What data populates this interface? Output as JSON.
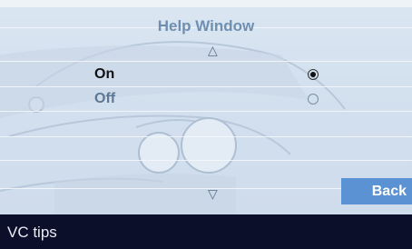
{
  "window": {
    "title": "Help Window"
  },
  "nav": {
    "up_icon": "triangle-up-icon",
    "up_glyph": "△",
    "down_icon": "triangle-down-icon",
    "down_glyph": "▽"
  },
  "options": [
    {
      "label": "On",
      "selected": true
    },
    {
      "label": "Off",
      "selected": false
    }
  ],
  "buttons": {
    "back_label": "Back"
  },
  "status": {
    "text": "VC tips"
  },
  "colors": {
    "background": "#d3e0ee",
    "title": "#6f8fb1",
    "selected_text": "#111111",
    "unselected_text": "#5d7893",
    "back_button": "#5b92d3",
    "status_bar": "#0b0f2a"
  }
}
